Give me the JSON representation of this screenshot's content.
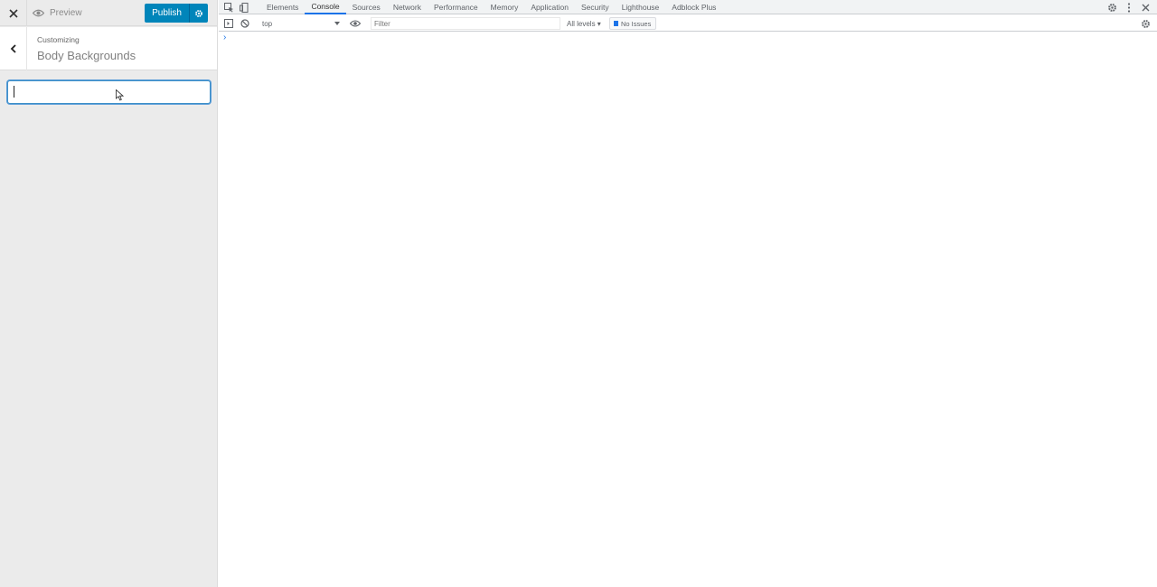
{
  "customizer": {
    "close_icon": "close-icon",
    "preview_label": "Preview",
    "publish_label": "Publish",
    "section_parent": "Customizing",
    "section_title": "Body Backgrounds",
    "search_value": ""
  },
  "devtools": {
    "tabs": [
      {
        "label": "Elements",
        "active": false
      },
      {
        "label": "Console",
        "active": true
      },
      {
        "label": "Sources",
        "active": false
      },
      {
        "label": "Network",
        "active": false
      },
      {
        "label": "Performance",
        "active": false
      },
      {
        "label": "Memory",
        "active": false
      },
      {
        "label": "Application",
        "active": false
      },
      {
        "label": "Security",
        "active": false
      },
      {
        "label": "Lighthouse",
        "active": false
      },
      {
        "label": "Adblock Plus",
        "active": false
      }
    ],
    "context": "top",
    "filter_placeholder": "Filter",
    "levels": "All levels ▾",
    "issues": "No Issues",
    "prompt": "›"
  },
  "colors": {
    "publish_blue": "#0085ba",
    "devtools_accent": "#1a73e8"
  }
}
